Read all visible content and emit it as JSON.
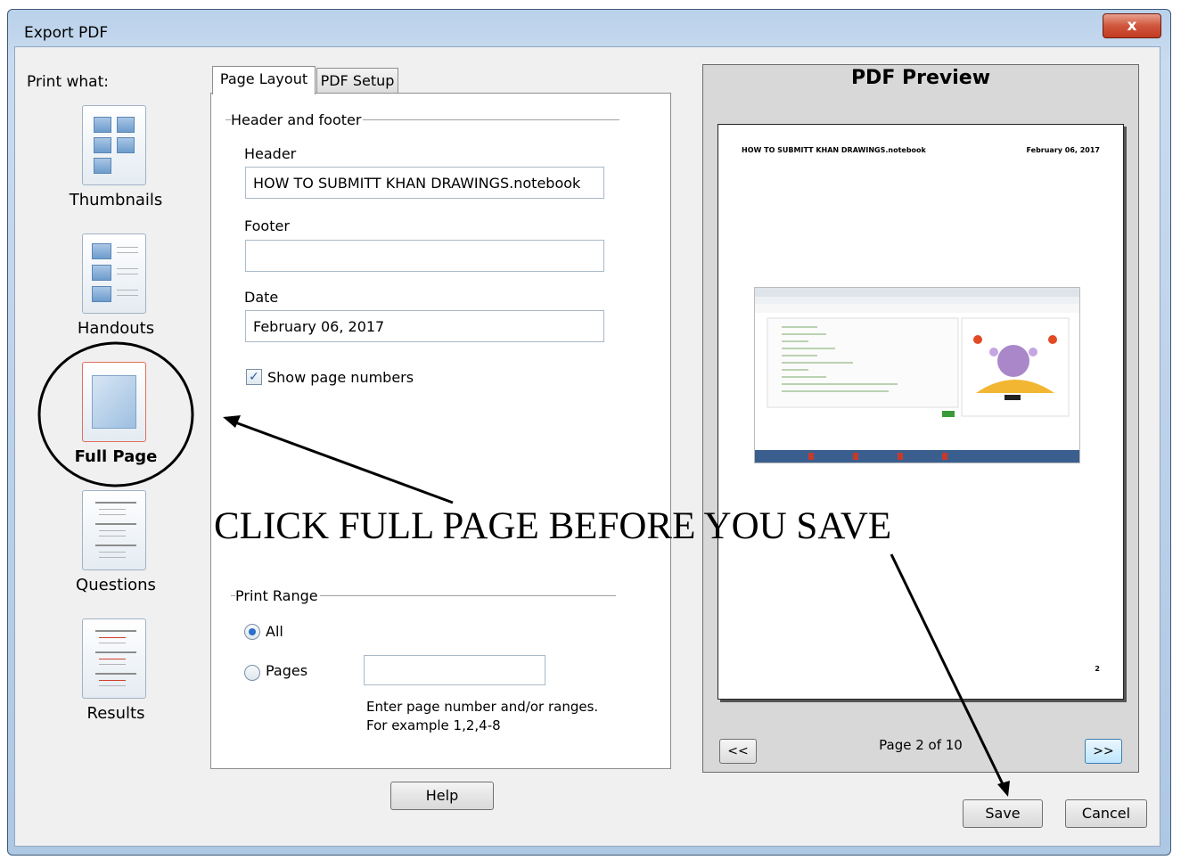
{
  "window": {
    "title": "Export PDF",
    "close_glyph": "x"
  },
  "left": {
    "heading": "Print what:",
    "options": [
      {
        "label": "Thumbnails",
        "icon": "thumbnails-icon",
        "selected": false
      },
      {
        "label": "Handouts",
        "icon": "handouts-icon",
        "selected": false
      },
      {
        "label": "Full Page",
        "icon": "full-page-icon",
        "selected": true
      },
      {
        "label": "Questions",
        "icon": "questions-icon",
        "selected": false
      },
      {
        "label": "Results",
        "icon": "results-icon",
        "selected": false
      }
    ]
  },
  "tabs": [
    {
      "label": "Page Layout",
      "active": true
    },
    {
      "label": "PDF Setup",
      "active": false
    }
  ],
  "header_footer": {
    "group_label": "Header and footer",
    "header_label": "Header",
    "header_value": "HOW TO SUBMITT KHAN DRAWINGS.notebook",
    "footer_label": "Footer",
    "footer_value": "",
    "date_label": "Date",
    "date_value": "February 06, 2017",
    "show_page_numbers_label": "Show page numbers",
    "show_page_numbers_checked": true
  },
  "print_range": {
    "group_label": "Print Range",
    "all_label": "All",
    "pages_label": "Pages",
    "pages_value": "",
    "selected": "All",
    "hint_line1": "Enter page number and/or ranges.",
    "hint_line2": "For example 1,2,4-8"
  },
  "buttons": {
    "help": "Help",
    "save": "Save",
    "cancel": "Cancel"
  },
  "preview": {
    "title": "PDF Preview",
    "page_header_left": "HOW TO SUBMITT KHAN DRAWINGS.notebook",
    "page_header_right": "February 06, 2017",
    "page_number": "2",
    "prev_label": "<<",
    "next_label": ">>",
    "page_indicator": "Page 2 of 10"
  },
  "annotation": {
    "text": "CLICK FULL PAGE BEFORE  YOU SAVE"
  },
  "colors": {
    "window_frame": "#b9d1ea",
    "accent_blue": "#2a6fc9",
    "close_red": "#c23b22"
  }
}
